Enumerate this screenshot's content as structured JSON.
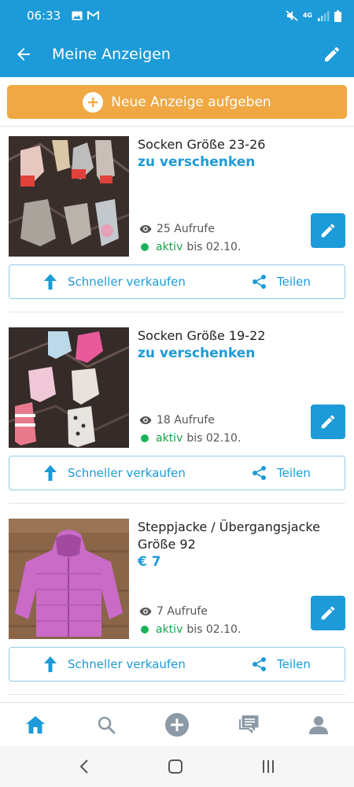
{
  "status_bar": {
    "time": "06:33",
    "network": "4G",
    "icons": [
      "gallery-icon",
      "gmail-icon",
      "mute-icon",
      "signal-icon",
      "battery-icon"
    ]
  },
  "app_bar": {
    "title": "Meine Anzeigen",
    "back_icon": "arrow-left-icon",
    "edit_icon": "pencil-icon"
  },
  "new_ad_button": {
    "label": "Neue Anzeige aufgeben",
    "icon": "plus-circle-icon"
  },
  "listings": [
    {
      "title": "Socken Größe 23-26",
      "price": "zu verschenken",
      "views": "25 Aufrufe",
      "status": "aktiv",
      "until": "bis 02.10.",
      "sell_label": "Schneller verkaufen",
      "share_label": "Teilen"
    },
    {
      "title": "Socken Größe 19-22",
      "price": "zu verschenken",
      "views": "18 Aufrufe",
      "status": "aktiv",
      "until": "bis 02.10.",
      "sell_label": "Schneller verkaufen",
      "share_label": "Teilen"
    },
    {
      "title": "Steppjacke / Übergangsjacke Größe 92",
      "price": "€ 7",
      "views": "7 Aufrufe",
      "status": "aktiv",
      "until": "bis 02.10.",
      "sell_label": "Schneller verkaufen",
      "share_label": "Teilen"
    }
  ],
  "bottom_nav": [
    "home-icon",
    "search-icon",
    "add-circle-icon",
    "messages-icon",
    "profile-icon"
  ],
  "colors": {
    "primary": "#1d9bd8",
    "accent_orange": "#f0a844",
    "active_green": "#19b35a"
  }
}
